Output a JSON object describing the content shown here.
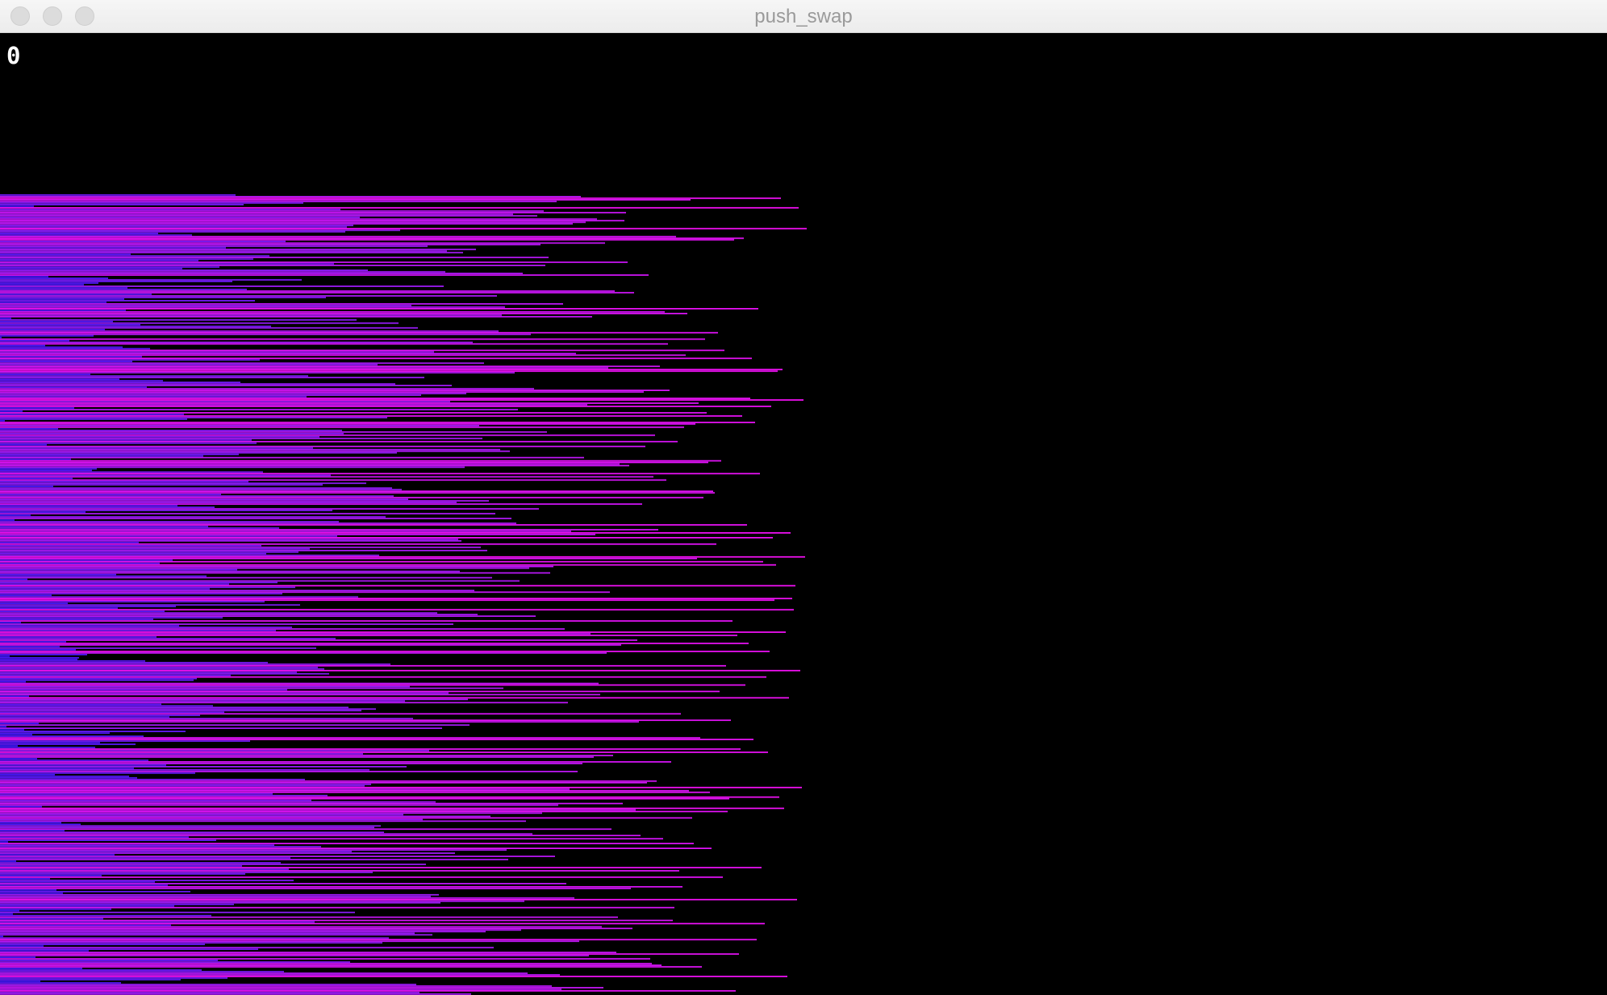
{
  "window": {
    "title": "push_swap",
    "controls": [
      "close",
      "minimize",
      "zoom"
    ]
  },
  "visualizer": {
    "operation_count": "0",
    "background": "#000000",
    "gradient_colors": {
      "short": "#3a18ff",
      "mid": "#9a1cff",
      "long": "#ff10ff"
    },
    "stack_a": {
      "element_count": 500,
      "max_value": 500,
      "sorted": false
    },
    "stack_b": {
      "element_count": 0
    }
  }
}
